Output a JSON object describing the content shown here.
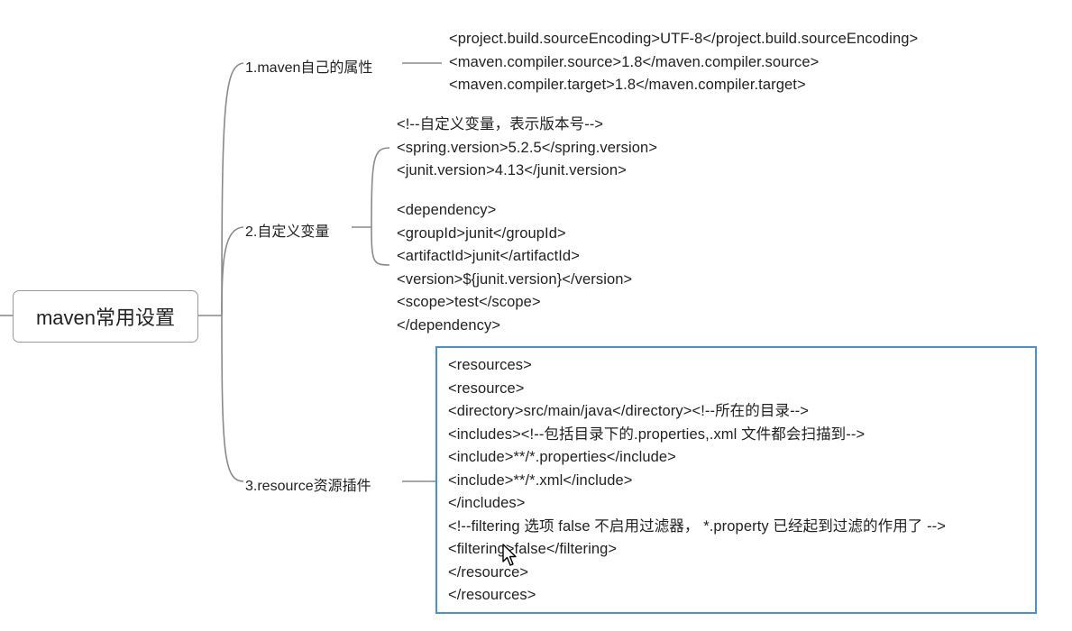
{
  "root": {
    "label": "maven常用设置"
  },
  "branches": [
    {
      "label": "1.maven自己的属性",
      "lines": [
        "<project.build.sourceEncoding>UTF-8</project.build.sourceEncoding>",
        "<maven.compiler.source>1.8</maven.compiler.source>",
        "<maven.compiler.target>1.8</maven.compiler.target>"
      ]
    },
    {
      "label": "2.自定义变量",
      "children": [
        {
          "lines": [
            "<!--自定义变量，表示版本号-->",
            "<spring.version>5.2.5</spring.version>",
            "<junit.version>4.13</junit.version>"
          ]
        },
        {
          "lines": [
            "<dependency>",
            "<groupId>junit</groupId>",
            "<artifactId>junit</artifactId>",
            "<version>${junit.version}</version>",
            "<scope>test</scope>",
            "</dependency>"
          ]
        }
      ]
    },
    {
      "label": "3.resource资源插件",
      "lines": [
        "<resources>",
        "<resource>",
        "<directory>src/main/java</directory><!--所在的目录-->",
        "<includes><!--包括目录下的.properties,.xml 文件都会扫描到-->",
        "<include>**/*.properties</include>",
        "<include>**/*.xml</include>",
        "</includes>",
        "<!--filtering 选项 false 不启用过滤器， *.property 已经起到过滤的作用了 -->",
        "<filtering>false</filtering>",
        "</resource>",
        "</resources>"
      ]
    }
  ],
  "colors": {
    "connector": "#8a8a8a",
    "root_border": "#9a9a9a",
    "selection_border": "#4a90d9"
  }
}
